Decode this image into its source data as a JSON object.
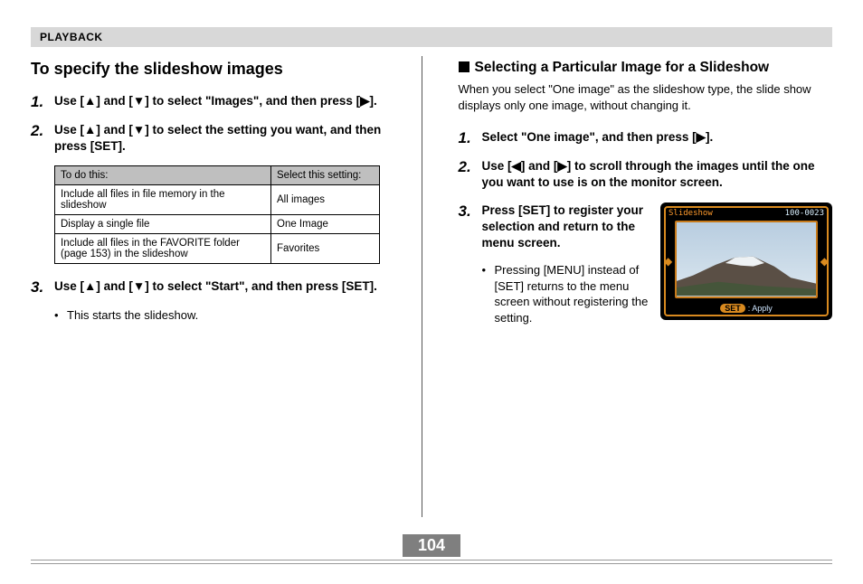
{
  "header": {
    "section": "PLAYBACK"
  },
  "left": {
    "title": "To specify the slideshow images",
    "steps": [
      {
        "num": "1.",
        "text": "Use [▲] and [▼] to select \"Images\", and then press [▶]."
      },
      {
        "num": "2.",
        "text": "Use [▲] and [▼] to select the setting you want, and then press [SET]."
      },
      {
        "num": "3.",
        "text": "Use [▲] and [▼] to select \"Start\", and then press [SET]."
      }
    ],
    "bullet3": "This starts the slideshow.",
    "table": {
      "head": [
        "To do this:",
        "Select this setting:"
      ],
      "rows": [
        [
          "Include all files in file memory in the slideshow",
          "All images"
        ],
        [
          "Display a single file",
          "One Image"
        ],
        [
          "Include all files in the FAVORITE folder (page 153) in the slideshow",
          "Favorites"
        ]
      ]
    }
  },
  "right": {
    "subhead": "Selecting a Particular Image for a Slideshow",
    "intro": "When you select \"One image\" as the slideshow type, the slide show displays only one image, without changing it.",
    "steps": [
      {
        "num": "1.",
        "text": "Select \"One image\", and then press [▶]."
      },
      {
        "num": "2.",
        "text": "Use [◀] and [▶] to scroll through the images until the one you want to use is on the monitor screen."
      },
      {
        "num": "3.",
        "text": "Press [SET] to register your selection and return to the menu screen."
      }
    ],
    "bullet3": "Pressing [MENU] instead of [SET] returns to the menu screen without registering the setting.",
    "camera": {
      "title": "Slideshow",
      "counter": "100-0023",
      "set_label": "SET",
      "apply": ": Apply"
    }
  },
  "page_number": "104"
}
